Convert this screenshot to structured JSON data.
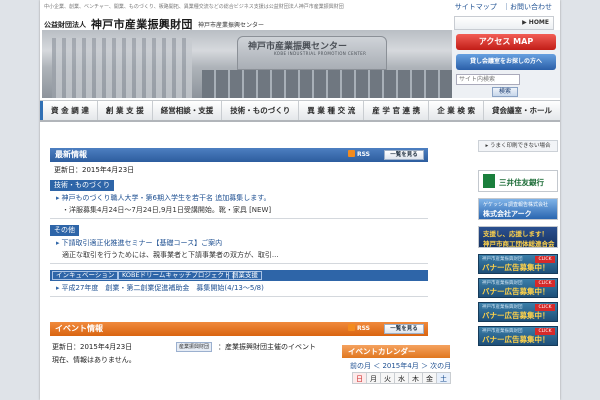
{
  "header": {
    "tagline": "中小企業、創業、ベンチャー、開業、ものづくり、販路開拓、異業種交流などの総合ビジネス支援は公益財団法人神戸市産業振興財団",
    "util_links": [
      "サイトマップ",
      "｜お問い合わせ"
    ],
    "org_prefix": "公益財団法人",
    "org_name": "神戸市産業振興財団",
    "org_center": "神戸市産業振興センター",
    "home_label": "HOME"
  },
  "hero": {
    "sign_text": "神戸市産業振興センター",
    "sign_sub": "KOBE INDUSTRIAL PROMOTION CENTER"
  },
  "sidebar_top": {
    "access_label": "アクセス MAP",
    "rent_label": "貸し会議室をお探しの方へ",
    "search_placeholder": "サイト内検索",
    "search_button": "検索"
  },
  "gnav": [
    "資 金 調 達",
    "創 業 支 援",
    "経営相談・支援",
    "技術・ものづくり",
    "異 業 種 交 流",
    "産 学 官 連 携",
    "企 業 検 索",
    "貸会議室・ホール"
  ],
  "news": {
    "title": "最新情報",
    "rss_label": "RSS",
    "more_label": "一覧を見る",
    "updated": "更新日：2015年4月23日",
    "sections": [
      {
        "category": "技術・ものづくり",
        "items": [
          {
            "title": "神戸ものづくり職人大学・第6期入学生を若干名 追加募集します。",
            "sub": "洋服募集4月24日～7月24日,9月1日受講開始。靴・家具 [NEW]"
          }
        ]
      },
      {
        "category": "その他",
        "items": [
          {
            "title": "下請取引適正化推進セミナー【基礎コース】ご案内",
            "sub": "適正な取引を行うためには、親事業者と下請事業者の双方が、取引..."
          }
        ]
      }
    ],
    "tags": [
      "インキュベーション",
      "KOBEドリームキャッチプロジェクト",
      "創業支援"
    ],
    "tag_item": "平成27年度　創業・第二創業促進補助金　募集開始(4/13～5/8)"
  },
  "event": {
    "title": "イベント情報",
    "rss_label": "RSS",
    "more_label": "一覧を見る",
    "updated": "更新日：2015年4月23日",
    "badge": "産業振興財団",
    "legend": "：産業振興財団主催のイベント",
    "empty": "現在、情報はありません。"
  },
  "calendar": {
    "title": "イベントカレンダー",
    "nav": "前の月 ＜ 2015年4月 ＞ 次の月",
    "days": [
      "日",
      "月",
      "火",
      "水",
      "木",
      "金",
      "土"
    ]
  },
  "right": {
    "print_link": "うまく印刷できない場合",
    "smbc_name": "三井住友銀行",
    "smbc_mark": "SMBC",
    "arc_small": "ゲケッショ調査報告株式会社",
    "arc_name": "株式会社アーク",
    "shoko_top": "支援し、応援します！",
    "shoko_bot": "神戸市商工団体総連合会",
    "banners": [
      {
        "small": "神戸市産業振興財団",
        "label": "バナー広告募集中！",
        "click": "CLICK"
      },
      {
        "small": "神戸市産業振興財団",
        "label": "バナー広告募集中！",
        "click": "CLICK"
      },
      {
        "small": "神戸市産業振興財団",
        "label": "バナー広告募集中！",
        "click": "CLICK"
      },
      {
        "small": "神戸市産業振興財団",
        "label": "バナー広告募集中！",
        "click": "CLICK"
      }
    ]
  }
}
